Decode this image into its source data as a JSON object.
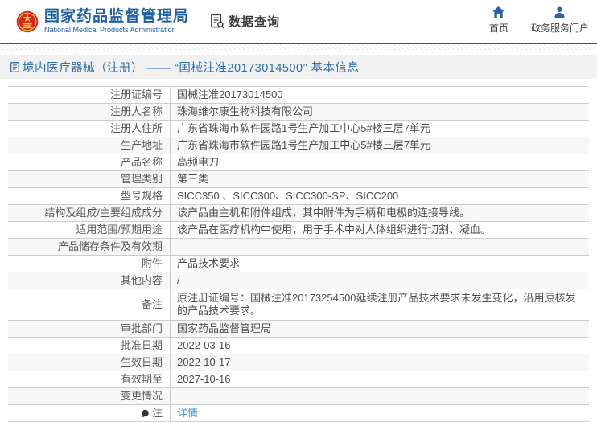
{
  "header": {
    "org_name_zh": "国家药品监督管理局",
    "org_name_en": "National Medical Products Administration",
    "data_query_label": "数据查询",
    "nav_home": "首页",
    "nav_portal": "政务服务门户"
  },
  "page_title": "境内医疗器械（注册） —— “国械注准20173014500” 基本信息",
  "table": {
    "rows": [
      {
        "label": "注册证编号",
        "value": "国械注准20173014500"
      },
      {
        "label": "注册人名称",
        "value": "珠海维尔康生物科技有限公司"
      },
      {
        "label": "注册人住所",
        "value": "广东省珠海市软件园路1号生产加工中心5#楼三层7单元"
      },
      {
        "label": "生产地址",
        "value": "广东省珠海市软件园路1号生产加工中心5#楼三层7单元"
      },
      {
        "label": "产品名称",
        "value": "高频电刀"
      },
      {
        "label": "管理类别",
        "value": "第三类"
      },
      {
        "label": "型号规格",
        "value": "SICC350 、SICC300、SICC300-SP、SICC200"
      },
      {
        "label": "结构及组成/主要组成成分",
        "value": "该产品由主机和附件组成，其中附件为手柄和电极的连接导线。"
      },
      {
        "label": "适用范围/预期用途",
        "value": "该产品在医疗机构中使用，用于手术中对人体组织进行切割、凝血。"
      },
      {
        "label": "产品储存条件及有效期",
        "value": ""
      },
      {
        "label": "附件",
        "value": "产品技术要求"
      },
      {
        "label": "其他内容",
        "value": "/"
      },
      {
        "label": "备注",
        "value": "原注册证编号：国械注准20173254500延续注册产品技术要求未发生变化，沿用原核发的产品技术要求。"
      },
      {
        "label": "审批部门",
        "value": "国家药品监督管理局"
      },
      {
        "label": "批准日期",
        "value": "2022-03-16"
      },
      {
        "label": "生效日期",
        "value": "2022-10-17"
      },
      {
        "label": "有效期至",
        "value": "2027-10-16"
      },
      {
        "label": "变更情况",
        "value": ""
      },
      {
        "label": "注",
        "value": "详情"
      }
    ]
  },
  "colors": {
    "brand_blue": "#1c5fa8",
    "title_blue": "#2e6cab",
    "link_blue": "#3b9bd8",
    "header_rule_teal": "#25617f",
    "alt_row_bg": "#f7f7f7",
    "border_gray": "#cccccc"
  }
}
